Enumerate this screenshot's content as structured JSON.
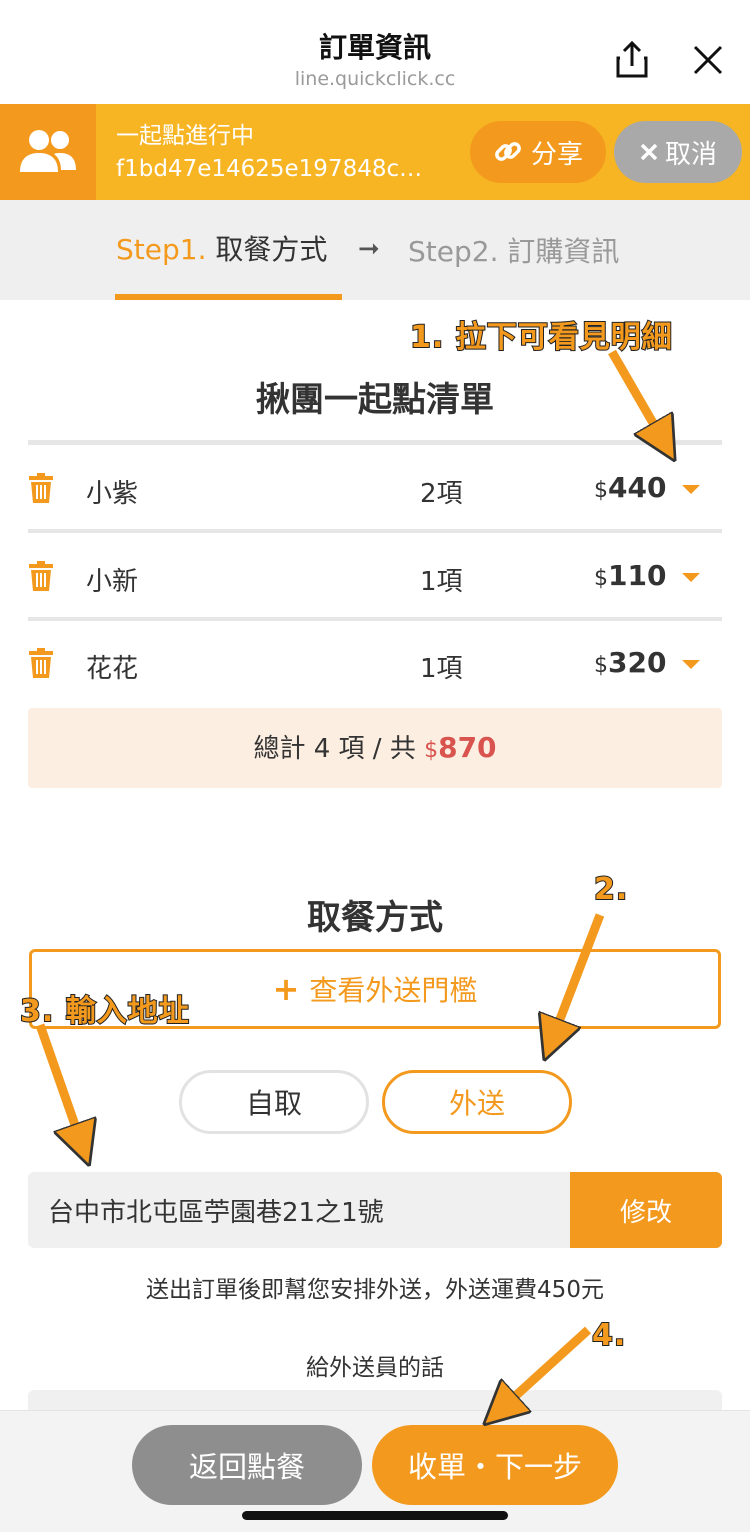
{
  "header": {
    "title": "訂單資訊",
    "url": "line.quickclick.cc"
  },
  "group": {
    "status": "一起點進行中",
    "id": "f1bd47e14625e197848c…",
    "share_label": "分享",
    "cancel_label": "取消"
  },
  "steps": {
    "step1_num": "Step1.",
    "step1_label": "取餐方式",
    "step2": "Step2. 訂購資訊"
  },
  "order_list": {
    "title": "揪團一起點清單",
    "currency": "$",
    "rows": [
      {
        "name": "小紫",
        "count": "2項",
        "amount": "440"
      },
      {
        "name": "小新",
        "count": "1項",
        "amount": "110"
      },
      {
        "name": "花花",
        "count": "1項",
        "amount": "320"
      }
    ],
    "total_prefix": "總計 4 項 / 共",
    "total_amount": "870"
  },
  "pickup": {
    "title": "取餐方式",
    "threshold_label": "查看外送門檻",
    "option_self": "自取",
    "option_delivery": "外送",
    "selected": "外送",
    "address": "台中市北屯區苧園巷21之1號",
    "edit_label": "修改",
    "note": "送出訂單後即幫您安排外送，外送運費450元",
    "courier_msg_label": "給外送員的話"
  },
  "footer": {
    "back_label": "返回點餐",
    "next_label": "收單・下一步"
  },
  "annotations": {
    "a1": "1. 拉下可看見明細",
    "a2": "2.",
    "a3": "3. 輸入地址",
    "a4": "4."
  },
  "colors": {
    "accent": "#f39a1e",
    "bar_yellow": "#f7b423",
    "total_red": "#d9534f"
  }
}
